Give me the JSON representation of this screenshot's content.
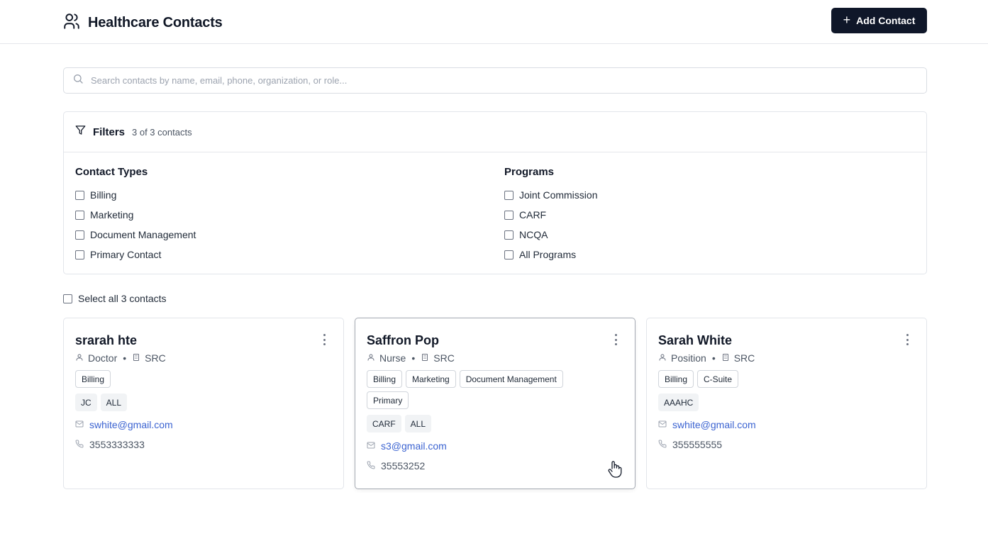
{
  "header": {
    "title": "Healthcare Contacts",
    "add_button": "Add Contact",
    "add_icon": "+"
  },
  "search": {
    "placeholder": "Search contacts by name, email, phone, organization, or role...",
    "value": ""
  },
  "filters": {
    "title": "Filters",
    "count_text": "3 of 3 contacts",
    "contact_types": {
      "heading": "Contact Types",
      "options": [
        "Billing",
        "Marketing",
        "Document Management",
        "Primary Contact"
      ]
    },
    "programs": {
      "heading": "Programs",
      "options": [
        "Joint Commission",
        "CARF",
        "NCQA",
        "All Programs"
      ]
    }
  },
  "select_all_label": "Select all 3 contacts",
  "contacts": [
    {
      "name": "srarah hte",
      "role": "Doctor",
      "separator": "•",
      "organization": "SRC",
      "types": [
        "Billing"
      ],
      "programs": [
        "JC",
        "ALL"
      ],
      "email": "swhite@gmail.com",
      "phone": "3553333333"
    },
    {
      "name": "Saffron Pop",
      "role": "Nurse",
      "separator": "•",
      "organization": "SRC",
      "types": [
        "Billing",
        "Marketing",
        "Document Management",
        "Primary"
      ],
      "programs": [
        "CARF",
        "ALL"
      ],
      "email": "s3@gmail.com",
      "phone": "35553252"
    },
    {
      "name": "Sarah White",
      "role": "Position",
      "separator": "•",
      "organization": "SRC",
      "types": [
        "Billing",
        "C-Suite"
      ],
      "programs": [
        "AAAHC"
      ],
      "email": "swhite@gmail.com",
      "phone": "355555555"
    }
  ],
  "colors": {
    "primary_button": "#0f1729",
    "email_link": "#3b63d1",
    "border": "#e2e5ea"
  }
}
